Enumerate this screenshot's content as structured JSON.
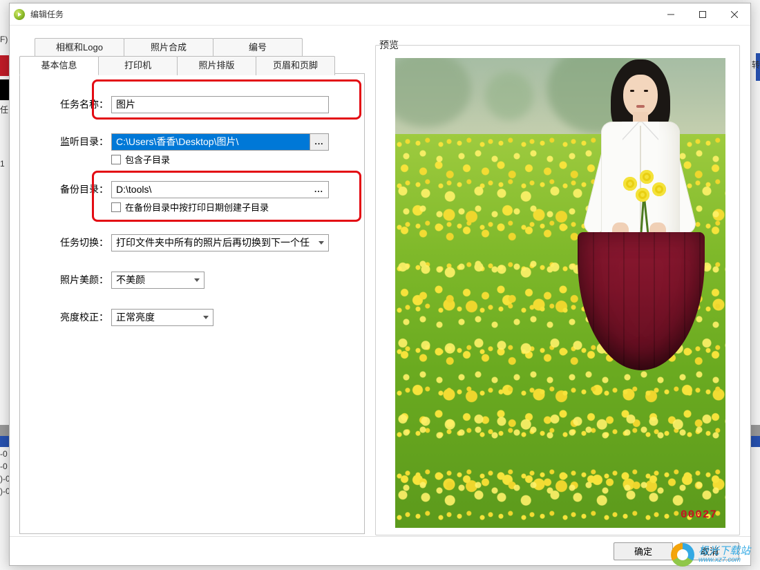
{
  "window": {
    "title": "编辑任务"
  },
  "tabs": {
    "row1": [
      "相框和Logo",
      "照片合成",
      "编号"
    ],
    "row2": [
      "基本信息",
      "打印机",
      "照片排版",
      "页眉和页脚"
    ]
  },
  "form": {
    "task_name": {
      "label": "任务名称：",
      "value": "图片"
    },
    "listen_dir": {
      "label": "监听目录：",
      "value": "C:\\Users\\香香\\Desktop\\图片\\",
      "browse": "..."
    },
    "include_sub": {
      "label": "包含子目录"
    },
    "backup_dir": {
      "label": "备份目录：",
      "value": "D:\\tools\\",
      "browse": "..."
    },
    "backup_by_date": {
      "label": "在备份目录中按打印日期创建子目录"
    },
    "task_switch": {
      "label": "任务切换：",
      "value": "打印文件夹中所有的照片后再切换到下一个任"
    },
    "beautify": {
      "label": "照片美颜：",
      "value": "不美颜"
    },
    "brightness": {
      "label": "亮度校正：",
      "value": "正常亮度"
    }
  },
  "preview": {
    "label": "预览",
    "stamp": "00027"
  },
  "footer": {
    "ok": "确定",
    "cancel": "取消"
  },
  "bg": {
    "edge0": "1",
    "edgeG": "任",
    "edge1": "-0",
    "edge2": "-0",
    "edge3": ")-0",
    "edge4": ")-0",
    "ftext": "F)",
    "ztext": "转"
  },
  "watermark": {
    "main": "极光下载站",
    "sub": "www.xz7.com"
  }
}
